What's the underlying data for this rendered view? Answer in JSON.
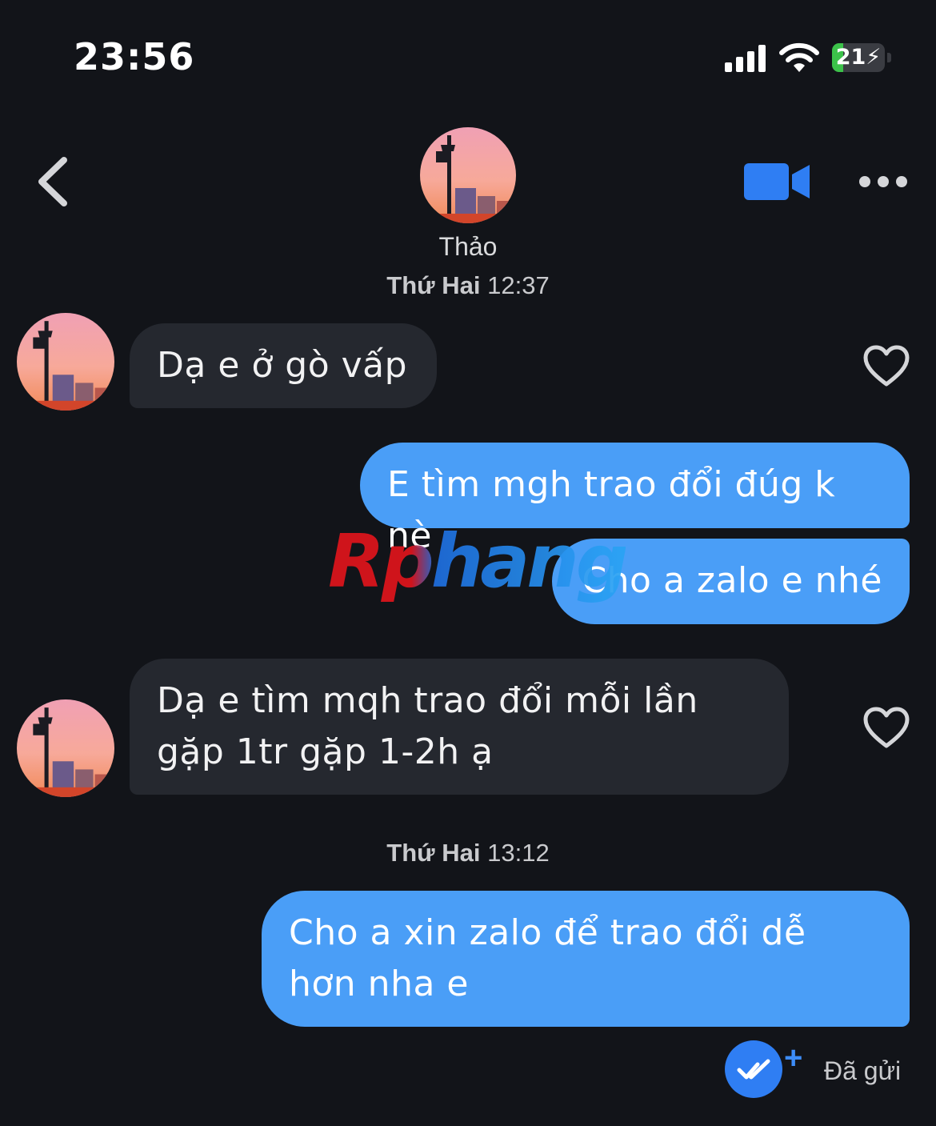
{
  "status_bar": {
    "time": "23:56",
    "battery_level": "21",
    "battery_fraction": 0.21,
    "icons": [
      "signal-icon",
      "wifi-icon",
      "battery-charging-icon"
    ]
  },
  "header": {
    "contact_name": "Thảo",
    "icons": [
      "back-chevron-icon",
      "video-call-icon",
      "more-options-icon"
    ]
  },
  "conversation": {
    "timestamp_1_day": "Thứ Hai",
    "timestamp_1_time": "12:37",
    "timestamp_2_day": "Thứ Hai",
    "timestamp_2_time": "13:12",
    "messages": [
      {
        "direction": "incoming",
        "text": "Dạ e ở gò vấp"
      },
      {
        "direction": "outgoing",
        "text": "E tìm mgh trao đổi đúg k nè"
      },
      {
        "direction": "outgoing",
        "text": "Cho a zalo e nhé"
      },
      {
        "direction": "incoming",
        "text": "Dạ e tìm mqh trao đổi mỗi lần gặp 1tr gặp 1-2h ạ"
      },
      {
        "direction": "outgoing",
        "text": "Cho a xin zalo để trao đổi dễ hơn nha e"
      }
    ],
    "sent_status": "Đã gửi"
  },
  "watermark": "Rphang",
  "colors": {
    "background": "#121419",
    "incoming_bubble": "#25282f",
    "outgoing_bubble": "#4a9ef7",
    "accent": "#2f7ef3",
    "battery_green": "#3cc24a"
  }
}
